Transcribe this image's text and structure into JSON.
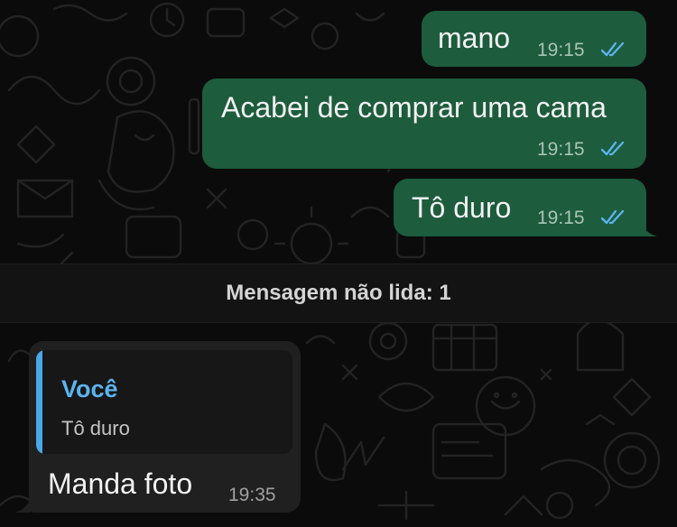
{
  "messages_out": [
    {
      "text": "mano",
      "time": "19:15"
    },
    {
      "text": "Acabei de comprar uma cama",
      "time": "19:15"
    },
    {
      "text": "Tô duro",
      "time": "19:15"
    }
  ],
  "unread_divider": {
    "text": "Mensagem não lida: 1"
  },
  "message_in": {
    "reply": {
      "author": "Você",
      "text": "Tô duro"
    },
    "text": "Manda foto",
    "time": "19:35"
  },
  "colors": {
    "background": "#0b0b0b",
    "outgoing_bubble": "#1d5c3d",
    "incoming_bubble": "#202020",
    "read_ticks": "#5ab5ee",
    "reply_accent": "#49a8e6"
  }
}
